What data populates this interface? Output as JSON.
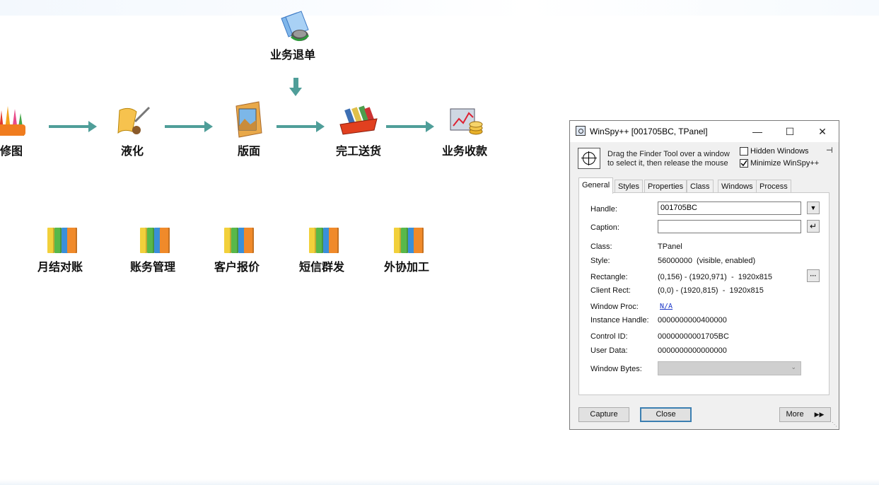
{
  "workflow": {
    "nodes": {
      "refund": "业务退单",
      "retouch": "修图",
      "liquefy": "液化",
      "layout": "版面",
      "delivery": "完工送货",
      "collection": "业务收款"
    },
    "tools": [
      "月结对账",
      "账务管理",
      "客户报价",
      "短信群发",
      "外协加工"
    ],
    "accent_color": "#4f9e99"
  },
  "winspy": {
    "title": "WinSpy++ [001705BC, TPanel]",
    "hint": "Drag the Finder Tool over a window to select it, then release the mouse",
    "hidden_windows_label": "Hidden Windows",
    "hidden_windows_checked": false,
    "minimize_label": "Minimize WinSpy++",
    "minimize_checked": true,
    "tabs": [
      "General",
      "Styles",
      "Properties",
      "Class",
      "Windows",
      "Process"
    ],
    "active_tab": "General",
    "general": {
      "handle_label": "Handle:",
      "handle_value": "001705BC",
      "caption_label": "Caption:",
      "caption_value": "",
      "class_label": "Class:",
      "class_value": "TPanel",
      "style_label": "Style:",
      "style_value": "56000000  (visible, enabled)",
      "rect_label": "Rectangle:",
      "rect_value": "(0,156) - (1920,971)  -  1920x815",
      "client_label": "Client Rect:",
      "client_value": "(0,0) - (1920,815)  -  1920x815",
      "proc_label": "Window Proc:",
      "proc_value": "N/A",
      "instance_label": "Instance Handle:",
      "instance_value": "0000000000400000",
      "ctrlid_label": "Control ID:",
      "ctrlid_value": "00000000001705BC",
      "userdata_label": "User Data:",
      "userdata_value": "0000000000000000",
      "bytes_label": "Window Bytes:"
    },
    "buttons": {
      "capture": "Capture",
      "close": "Close",
      "more": "More"
    }
  }
}
